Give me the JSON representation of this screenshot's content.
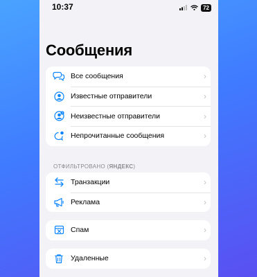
{
  "status_bar": {
    "time": "10:37",
    "battery": "72"
  },
  "title": "Сообщения",
  "main_group": [
    {
      "label": "Все сообщения",
      "icon": "chat-bubbles-icon"
    },
    {
      "label": "Известные отправители",
      "icon": "person-circle-icon"
    },
    {
      "label": "Неизвестные отправители",
      "icon": "person-question-icon"
    },
    {
      "label": "Непрочитанные сообщения",
      "icon": "unread-bubble-icon"
    }
  ],
  "filtered_header": {
    "prefix": "ОТФИЛЬТРОВАНО",
    "brand": "ЯНДЕКС"
  },
  "filtered_group": [
    {
      "label": "Транзакции",
      "icon": "arrows-exchange-icon"
    },
    {
      "label": "Реклама",
      "icon": "megaphone-icon"
    }
  ],
  "spam_group": [
    {
      "label": "Спам",
      "icon": "spam-tray-icon"
    }
  ],
  "deleted_group": [
    {
      "label": "Удаленные",
      "icon": "trash-icon"
    }
  ],
  "chevron": "›",
  "colors": {
    "accent": "#0a84ff",
    "background": "#f2f2f7"
  }
}
